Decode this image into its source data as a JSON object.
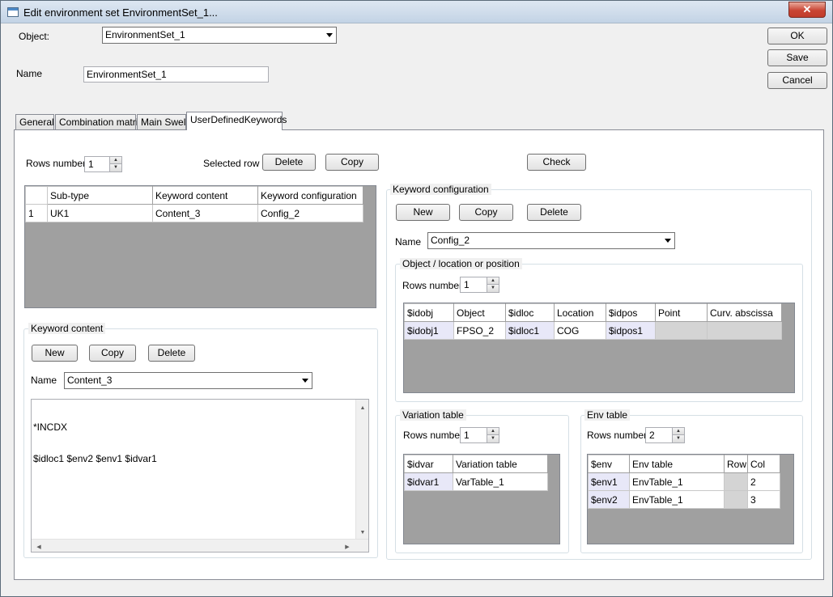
{
  "window": {
    "title": "Edit environment set EnvironmentSet_1...",
    "close_glyph": "✕"
  },
  "header": {
    "object_label": "Object:",
    "object_value": "EnvironmentSet_1",
    "name_label": "Name",
    "name_value": "EnvironmentSet_1"
  },
  "actions": {
    "ok": "OK",
    "save": "Save",
    "cancel": "Cancel"
  },
  "tabs": [
    {
      "label": "General"
    },
    {
      "label": "Combination matrix"
    },
    {
      "label": "Main Swell"
    },
    {
      "label": "UserDefinedKeywords"
    }
  ],
  "udk": {
    "rows_number_label": "Rows number",
    "rows_number_value": "1",
    "selected_row_label": "Selected row",
    "delete_label": "Delete",
    "copy_label": "Copy",
    "check_label": "Check",
    "main_table": {
      "headers": [
        "Sub-type",
        "Keyword content",
        "Keyword configuration"
      ],
      "rows": [
        {
          "index": "1",
          "cells": [
            "UK1",
            "Content_3",
            "Config_2"
          ]
        }
      ]
    },
    "keyword_content": {
      "group_label": "Keyword content",
      "new_label": "New",
      "copy_label": "Copy",
      "delete_label": "Delete",
      "name_label": "Name",
      "name_value": "Content_3",
      "text_line1": "*INCDX",
      "text_line2": "$idloc1 $env2 $env1 $idvar1"
    },
    "keyword_configuration": {
      "group_label": "Keyword configuration",
      "new_label": "New",
      "copy_label": "Copy",
      "delete_label": "Delete",
      "name_label": "Name",
      "name_value": "Config_2",
      "object_location": {
        "group_label": "Object / location or position",
        "rows_number_label": "Rows number",
        "rows_number_value": "1",
        "headers": [
          "$idobj",
          "Object",
          "$idloc",
          "Location",
          "$idpos",
          "Point",
          "Curv. abscissa"
        ],
        "rows": [
          [
            "$idobj1",
            "FPSO_2",
            "$idloc1",
            "COG",
            "$idpos1",
            "",
            ""
          ]
        ]
      },
      "variation_table": {
        "group_label": "Variation table",
        "rows_number_label": "Rows number",
        "rows_number_value": "1",
        "headers": [
          "$idvar",
          "Variation table"
        ],
        "rows": [
          [
            "$idvar1",
            "VarTable_1"
          ]
        ]
      },
      "env_table": {
        "group_label": "Env table",
        "rows_number_label": "Rows number",
        "rows_number_value": "2",
        "headers": [
          "$env",
          "Env table",
          "Row",
          "Col"
        ],
        "rows": [
          [
            "$env1",
            "EnvTable_1",
            "",
            "2"
          ],
          [
            "$env2",
            "EnvTable_1",
            "",
            "3"
          ]
        ]
      }
    }
  }
}
